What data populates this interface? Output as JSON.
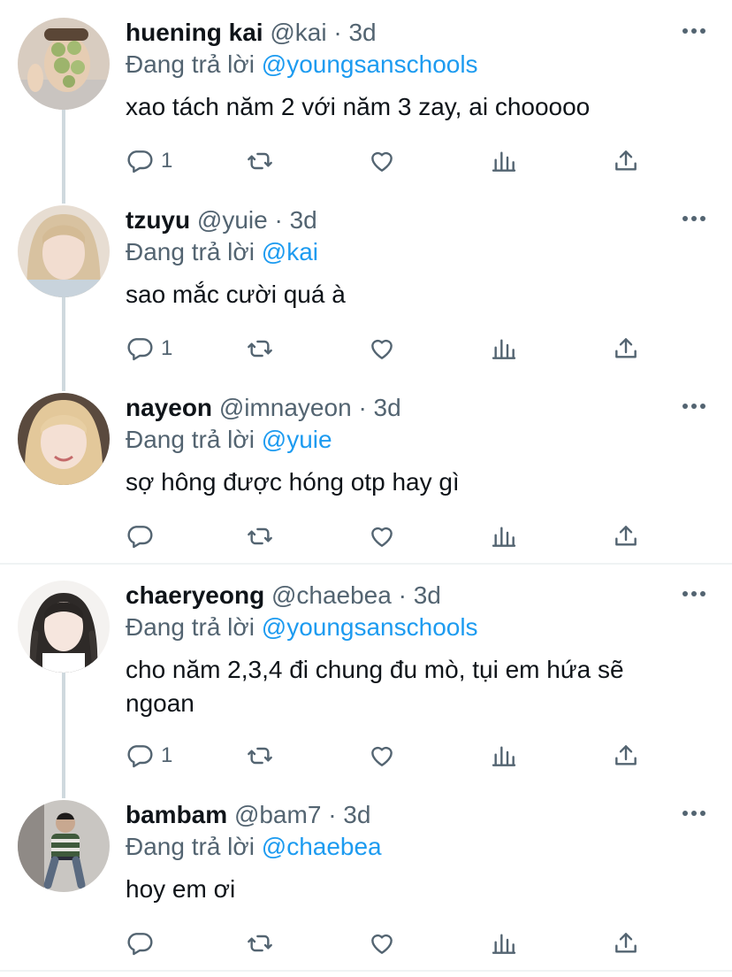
{
  "tweets": [
    {
      "name": "huening kai",
      "handle": "@kai",
      "time": "3d",
      "reply_label": "Đang trả lời",
      "reply_to": "@youngsanschools",
      "text": "xao tách năm 2 với năm 3 zay, ai chooooo",
      "reply_count": "1"
    },
    {
      "name": "tzuyu",
      "handle": "@yuie",
      "time": "3d",
      "reply_label": "Đang trả lời",
      "reply_to": "@kai",
      "text": "sao mắc cười quá à",
      "reply_count": "1"
    },
    {
      "name": "nayeon",
      "handle": "@imnayeon",
      "time": "3d",
      "reply_label": "Đang trả lời",
      "reply_to": "@yuie",
      "text": "sợ hông được hóng otp hay gì",
      "reply_count": ""
    },
    {
      "name": "chaeryeong",
      "handle": "@chaebea",
      "time": "3d",
      "reply_label": "Đang trả lời",
      "reply_to": "@youngsanschools",
      "text": "cho năm 2,3,4 đi chung đu mò, tụi em hứa sẽ ngoan",
      "reply_count": "1"
    },
    {
      "name": "bambam",
      "handle": "@bam7",
      "time": "3d",
      "reply_label": "Đang trả lời",
      "reply_to": "@chaebea",
      "text": "hoy em ơi",
      "reply_count": ""
    }
  ],
  "separator": "·",
  "icons": {
    "reply": "reply-bubble-icon",
    "retweet": "retweet-icon",
    "like": "heart-icon",
    "analytics": "analytics-bars-icon",
    "share": "share-upload-icon",
    "more": "more-dots-icon"
  },
  "colors": {
    "mention": "#1d9bf0",
    "secondary_text": "#536471",
    "thread_line": "#cfd9de",
    "divider": "#eff3f4"
  }
}
